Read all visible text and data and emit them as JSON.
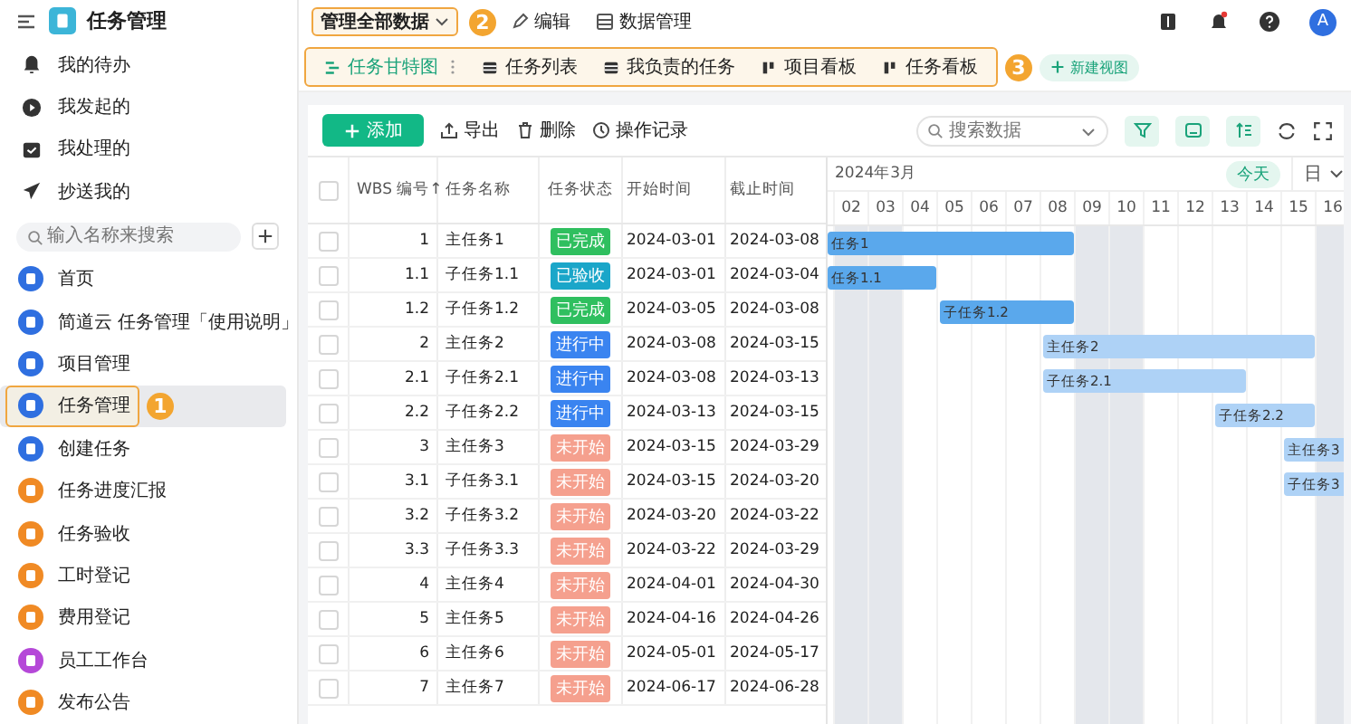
{
  "sidebar": {
    "app_title": "任务管理",
    "quick_items": [
      {
        "label": "我的待办"
      },
      {
        "label": "我发起的"
      },
      {
        "label": "我处理的"
      },
      {
        "label": "抄送我的"
      }
    ],
    "search": {
      "placeholder": "输入名称来搜索"
    },
    "items": [
      {
        "label": "首页",
        "color": "#2f6fe0",
        "selected": false
      },
      {
        "label": "简道云 任务管理「使用说明」",
        "color": "#2f6fe0",
        "selected": false
      },
      {
        "label": "项目管理",
        "color": "#2f6fe0",
        "selected": false
      },
      {
        "label": "任务管理",
        "color": "#2f6fe0",
        "selected": true,
        "badge": "1"
      },
      {
        "label": "创建任务",
        "color": "#2f6fe0",
        "selected": false
      },
      {
        "label": "任务进度汇报",
        "color": "#f08a24",
        "selected": false
      },
      {
        "label": "任务验收",
        "color": "#f08a24",
        "selected": false
      },
      {
        "label": "工时登记",
        "color": "#f08a24",
        "selected": false
      },
      {
        "label": "费用登记",
        "color": "#f08a24",
        "selected": false
      },
      {
        "label": "员工工作台",
        "color": "#b548d8",
        "selected": false
      },
      {
        "label": "发布公告",
        "color": "#f08a24",
        "selected": false
      }
    ]
  },
  "topbar": {
    "scope": "管理全部数据",
    "scope_badge": "2",
    "actions": [
      "编辑",
      "数据管理"
    ],
    "avatar": "A"
  },
  "views": {
    "tabs": [
      {
        "label": "任务甘特图",
        "selected": true
      },
      {
        "label": "任务列表",
        "selected": false
      },
      {
        "label": "我负责的任务",
        "selected": false
      },
      {
        "label": "项目看板",
        "selected": false
      },
      {
        "label": "任务看板",
        "selected": false
      }
    ],
    "badge": "3",
    "new_view": "新建视图"
  },
  "toolbar": {
    "add": "添加",
    "actions": [
      "导出",
      "删除",
      "操作记录"
    ],
    "search": {
      "placeholder": "搜索数据"
    }
  },
  "table": {
    "all_checked": false,
    "columns": [
      "WBS 编号↑",
      "任务名称",
      "任务状态",
      "开始时间",
      "截止时间"
    ],
    "rows": [
      {
        "checked": false,
        "wbs": "1",
        "name": "主任务1",
        "status": {
          "label": "已完成",
          "kind": "done"
        },
        "start": "2024-03-01",
        "end": "2024-03-08",
        "bar": {
          "label": "任务1",
          "color": "#5aa8ec"
        }
      },
      {
        "checked": false,
        "wbs": "1.1",
        "name": "子任务1.1",
        "status": {
          "label": "已验收",
          "kind": "accepted"
        },
        "start": "2024-03-01",
        "end": "2024-03-04",
        "bar": {
          "label": "任务1.1",
          "color": "#5aa8ec"
        }
      },
      {
        "checked": false,
        "wbs": "1.2",
        "name": "子任务1.2",
        "status": {
          "label": "已完成",
          "kind": "done"
        },
        "start": "2024-03-05",
        "end": "2024-03-08",
        "bar": {
          "label": "子任务1.2",
          "color": "#5aa8ec"
        }
      },
      {
        "checked": false,
        "wbs": "2",
        "name": "主任务2",
        "status": {
          "label": "进行中",
          "kind": "in_progress"
        },
        "start": "2024-03-08",
        "end": "2024-03-15",
        "bar": {
          "label": "主任务2",
          "color": "#aed2f6"
        }
      },
      {
        "checked": false,
        "wbs": "2.1",
        "name": "子任务2.1",
        "status": {
          "label": "进行中",
          "kind": "in_progress"
        },
        "start": "2024-03-08",
        "end": "2024-03-13",
        "bar": {
          "label": "子任务2.1",
          "color": "#aed2f6"
        }
      },
      {
        "checked": false,
        "wbs": "2.2",
        "name": "子任务2.2",
        "status": {
          "label": "进行中",
          "kind": "in_progress"
        },
        "start": "2024-03-13",
        "end": "2024-03-15",
        "bar": {
          "label": "子任务2.2",
          "color": "#aed2f6"
        }
      },
      {
        "checked": false,
        "wbs": "3",
        "name": "主任务3",
        "status": {
          "label": "未开始",
          "kind": "not_started"
        },
        "start": "2024-03-15",
        "end": "2024-03-29",
        "bar": {
          "label": "主任务3",
          "color": "#aed2f6"
        }
      },
      {
        "checked": false,
        "wbs": "3.1",
        "name": "子任务3.1",
        "status": {
          "label": "未开始",
          "kind": "not_started"
        },
        "start": "2024-03-15",
        "end": "2024-03-20",
        "bar": {
          "label": "子任务3",
          "color": "#aed2f6"
        }
      },
      {
        "checked": false,
        "wbs": "3.2",
        "name": "子任务3.2",
        "status": {
          "label": "未开始",
          "kind": "not_started"
        },
        "start": "2024-03-20",
        "end": "2024-03-22"
      },
      {
        "checked": false,
        "wbs": "3.3",
        "name": "子任务3.3",
        "status": {
          "label": "未开始",
          "kind": "not_started"
        },
        "start": "2024-03-22",
        "end": "2024-03-29"
      },
      {
        "checked": false,
        "wbs": "4",
        "name": "主任务4",
        "status": {
          "label": "未开始",
          "kind": "not_started"
        },
        "start": "2024-04-01",
        "end": "2024-04-30"
      },
      {
        "checked": false,
        "wbs": "5",
        "name": "主任务5",
        "status": {
          "label": "未开始",
          "kind": "not_started"
        },
        "start": "2024-04-16",
        "end": "2024-04-26"
      },
      {
        "checked": false,
        "wbs": "6",
        "name": "主任务6",
        "status": {
          "label": "未开始",
          "kind": "not_started"
        },
        "start": "2024-05-01",
        "end": "2024-05-17"
      },
      {
        "checked": false,
        "wbs": "7",
        "name": "主任务7",
        "status": {
          "label": "未开始",
          "kind": "not_started"
        },
        "start": "2024-06-17",
        "end": "2024-06-28"
      }
    ]
  },
  "gantt": {
    "month": "2024年3月",
    "today": "今天",
    "scale": "日",
    "days": [
      {
        "label": "02",
        "weekend": true
      },
      {
        "label": "03",
        "weekend": true
      },
      {
        "label": "04",
        "weekend": false
      },
      {
        "label": "05",
        "weekend": false
      },
      {
        "label": "06",
        "weekend": false
      },
      {
        "label": "07",
        "weekend": false
      },
      {
        "label": "08",
        "weekend": false
      },
      {
        "label": "09",
        "weekend": true
      },
      {
        "label": "10",
        "weekend": true
      },
      {
        "label": "11",
        "weekend": false
      },
      {
        "label": "12",
        "weekend": false
      },
      {
        "label": "13",
        "weekend": false
      },
      {
        "label": "14",
        "weekend": false
      },
      {
        "label": "15",
        "weekend": false
      },
      {
        "label": "16",
        "weekend": true
      }
    ]
  }
}
